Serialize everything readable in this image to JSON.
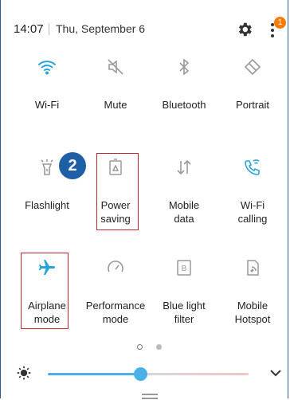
{
  "status": {
    "time": "14:07",
    "date": "Thu, September 6",
    "notification_count": "1"
  },
  "tiles": [
    {
      "label": "Wi-Fi",
      "icon": "wifi-icon",
      "active": true
    },
    {
      "label": "Mute",
      "icon": "mute-icon",
      "active": false
    },
    {
      "label": "Bluetooth",
      "icon": "bluetooth-icon",
      "active": false
    },
    {
      "label": "Portrait",
      "icon": "portrait-icon",
      "active": false
    },
    {
      "label": "Flashlight",
      "icon": "flashlight-icon",
      "active": false
    },
    {
      "label": "Power saving",
      "icon": "power-saving-icon",
      "active": false
    },
    {
      "label": "Mobile data",
      "icon": "mobile-data-icon",
      "active": false
    },
    {
      "label": "Wi-Fi calling",
      "icon": "wifi-calling-icon",
      "active": true
    },
    {
      "label": "Airplane mode",
      "icon": "airplane-icon",
      "active": true
    },
    {
      "label": "Performance mode",
      "icon": "performance-icon",
      "active": false
    },
    {
      "label": "Blue light filter",
      "icon": "blue-light-icon",
      "active": false
    },
    {
      "label": "Mobile Hotspot",
      "icon": "hotspot-icon",
      "active": false
    }
  ],
  "tile_labels": {
    "t0a": "Wi-Fi",
    "t1a": "Mute",
    "t2a": "Bluetooth",
    "t3a": "Portrait",
    "t4a": "Flashlight",
    "t5a": "Power",
    "t5b": "saving",
    "t6a": "Mobile",
    "t6b": "data",
    "t7a": "Wi-Fi",
    "t7b": "calling",
    "t8a": "Airplane",
    "t8b": "mode",
    "t9a": "Performance",
    "t9b": "mode",
    "t10a": "Blue light",
    "t10b": "filter",
    "t11a": "Mobile",
    "t11b": "Hotspot"
  },
  "callout_badge": "2",
  "pager": {
    "current_page": 1,
    "total_pages": 2
  },
  "brightness": {
    "level": 0.46
  },
  "colors": {
    "accent": "#29a3dd",
    "inactive": "#9a9a9a",
    "highlight": "#c0282d",
    "badge": "#1f5fa5",
    "notification": "#ff7a00"
  }
}
